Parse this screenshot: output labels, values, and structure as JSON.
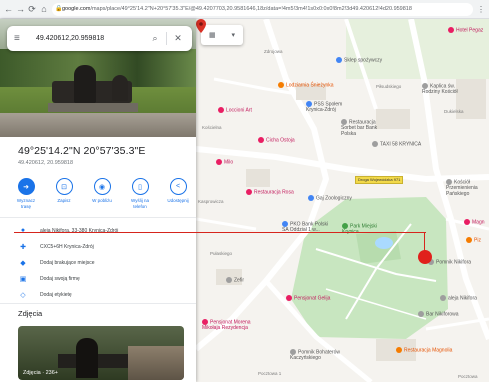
{
  "browser": {
    "back": "←",
    "forward": "→",
    "reload": "⟳",
    "home": "⌂",
    "url_host": "google.com",
    "url_rest": "/maps/place/49°25'14.2\"N+20°57'35.3\"E/@49.4207703,20.9581646,18z/data=!4m5!3m4!1s0x0:0x0!8m2!3d49.420612!4d20.959818",
    "menu": "⋮"
  },
  "search": {
    "query": "49.420612,20.959818",
    "menu_icon": "≡",
    "search_icon": "⌕",
    "close_icon": "✕"
  },
  "place": {
    "coords_dms": "49°25'14.2\"N 20°57'35.3\"E",
    "coords_decimal": "49.420612, 20.959818"
  },
  "actions": [
    {
      "label": "Wyznacz trasę",
      "icon": "➜"
    },
    {
      "label": "Zapisz",
      "icon": "⊡"
    },
    {
      "label": "W pobliżu",
      "icon": "◉"
    },
    {
      "label": "Wyślij na telefon",
      "icon": "▯"
    },
    {
      "label": "Udostępnij",
      "icon": "<"
    }
  ],
  "info": [
    {
      "icon": "●",
      "text": "aleja Nikifora, 33-380 Krynica-Zdrój"
    },
    {
      "icon": "✚",
      "text": "CXC5+6H Krynica-Zdrój"
    },
    {
      "icon": "◆",
      "text": "Dodaj brakujące miejsce"
    },
    {
      "icon": "▣",
      "text": "Dodaj swoją firmę"
    },
    {
      "icon": "◇",
      "text": "Dodaj etykietę"
    }
  ],
  "photos": {
    "title": "Zdjęcia",
    "caption": "Zdjęcia · 236+"
  },
  "map": {
    "layers_icon": "▦",
    "layers_caret": "▾",
    "pois": [
      {
        "name": "Sklep spożywczy",
        "kind": "blue"
      },
      {
        "name": "Lodziarnia Śnieżynka",
        "kind": "orange"
      },
      {
        "name": "PSS Społem Krynica-Zdrój",
        "kind": "blue"
      },
      {
        "name": "Restauracja Sorbet bar Bank Polska",
        "kind": "gray"
      },
      {
        "name": "Kaplica św. Rodziny Kościół",
        "kind": "gray"
      },
      {
        "name": "TAXI 58 KRYNICA",
        "kind": "gray"
      },
      {
        "name": "Loccioni Art",
        "kind": "pink"
      },
      {
        "name": "Cicha Ostoja",
        "kind": "pink"
      },
      {
        "name": "Milo",
        "kind": "pink"
      },
      {
        "name": "Gaj Zoologiczny",
        "kind": "blue"
      },
      {
        "name": "PKO Bank Polski SA Oddział 1 w...",
        "kind": "blue"
      },
      {
        "name": "Park Miejski Krynica",
        "kind": "green"
      },
      {
        "name": "Pomnik Nikifora",
        "kind": "gray"
      },
      {
        "name": "Zefir",
        "kind": "gray"
      },
      {
        "name": "Pensjonat Gelija",
        "kind": "pink"
      },
      {
        "name": "Restauracja Rosa",
        "kind": "pink"
      },
      {
        "name": "Pensjonat Morena Mikołaja Rezydencja",
        "kind": "pink"
      },
      {
        "name": "aleja Nikifora",
        "kind": "gray"
      },
      {
        "name": "Bar Nikiforowa",
        "kind": "gray"
      },
      {
        "name": "Pomnik Bohaterów Kaczyńskiego",
        "kind": "gray"
      },
      {
        "name": "Restauracja Magnolia",
        "kind": "orange"
      },
      {
        "name": "Kościół Przemienienia Pańskiego",
        "kind": "gray"
      },
      {
        "name": "Hotel Pegaz",
        "kind": "pink"
      },
      {
        "name": "Magn",
        "kind": "pink"
      },
      {
        "name": "Piz",
        "kind": "orange"
      }
    ],
    "streets": [
      "Zdrojowa",
      "Kościelna",
      "Piłsudskiego",
      "Pułaskiego",
      "Dukielska",
      "Kasprowicza",
      "Pocztowa 1",
      "Pocztowa"
    ],
    "road_sign": "Droga Wojewódzka 971"
  },
  "colors": {
    "accent": "#1a73e8",
    "marker": "#e0201b",
    "park": "#c8e6c0",
    "road": "#ffffff",
    "mapbg": "#f5f3ef"
  }
}
